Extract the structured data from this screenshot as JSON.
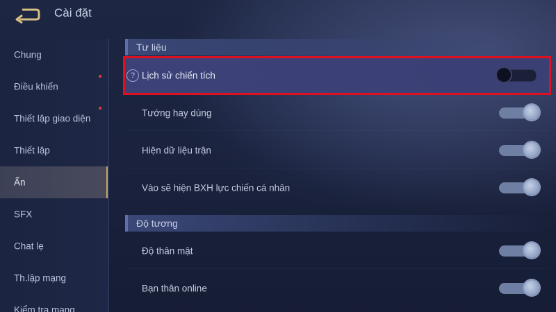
{
  "header": {
    "title": "Cài đặt",
    "back_icon": "back-arrow-icon"
  },
  "sidebar": {
    "items": [
      {
        "label": "Chung",
        "active": false,
        "badge": false
      },
      {
        "label": "Điều khiển",
        "active": false,
        "badge": true
      },
      {
        "label": "Thiết lập giao diện",
        "active": false,
        "badge": true
      },
      {
        "label": "Thiết lập",
        "active": false,
        "badge": false
      },
      {
        "label": "Ẩn",
        "active": true,
        "badge": false
      },
      {
        "label": "SFX",
        "active": false,
        "badge": false
      },
      {
        "label": "Chat lẹ",
        "active": false,
        "badge": false
      },
      {
        "label": "Th.lập mạng",
        "active": false,
        "badge": false
      },
      {
        "label": "Kiểm tra mạng",
        "active": false,
        "badge": false
      }
    ]
  },
  "sections": [
    {
      "title": "Tư liệu",
      "rows": [
        {
          "label": "Lịch sử chiến tích",
          "toggle": "off",
          "highlighted": true,
          "help_icon": true
        },
        {
          "label": "Tướng hay dùng",
          "toggle": "on"
        },
        {
          "label": "Hiện dữ liệu trận",
          "toggle": "on"
        },
        {
          "label": "Vào sẽ hiện BXH lực chiến cá nhân",
          "toggle": "on"
        }
      ]
    },
    {
      "title": "Độ tương",
      "rows": [
        {
          "label": "Độ thân mật",
          "toggle": "on"
        },
        {
          "label": "Bạn thân online",
          "toggle": "on"
        }
      ]
    }
  ],
  "colors": {
    "highlight_border": "#e0101f",
    "active_tab_accent": "#c7a861",
    "badge": "#e23b3b"
  }
}
